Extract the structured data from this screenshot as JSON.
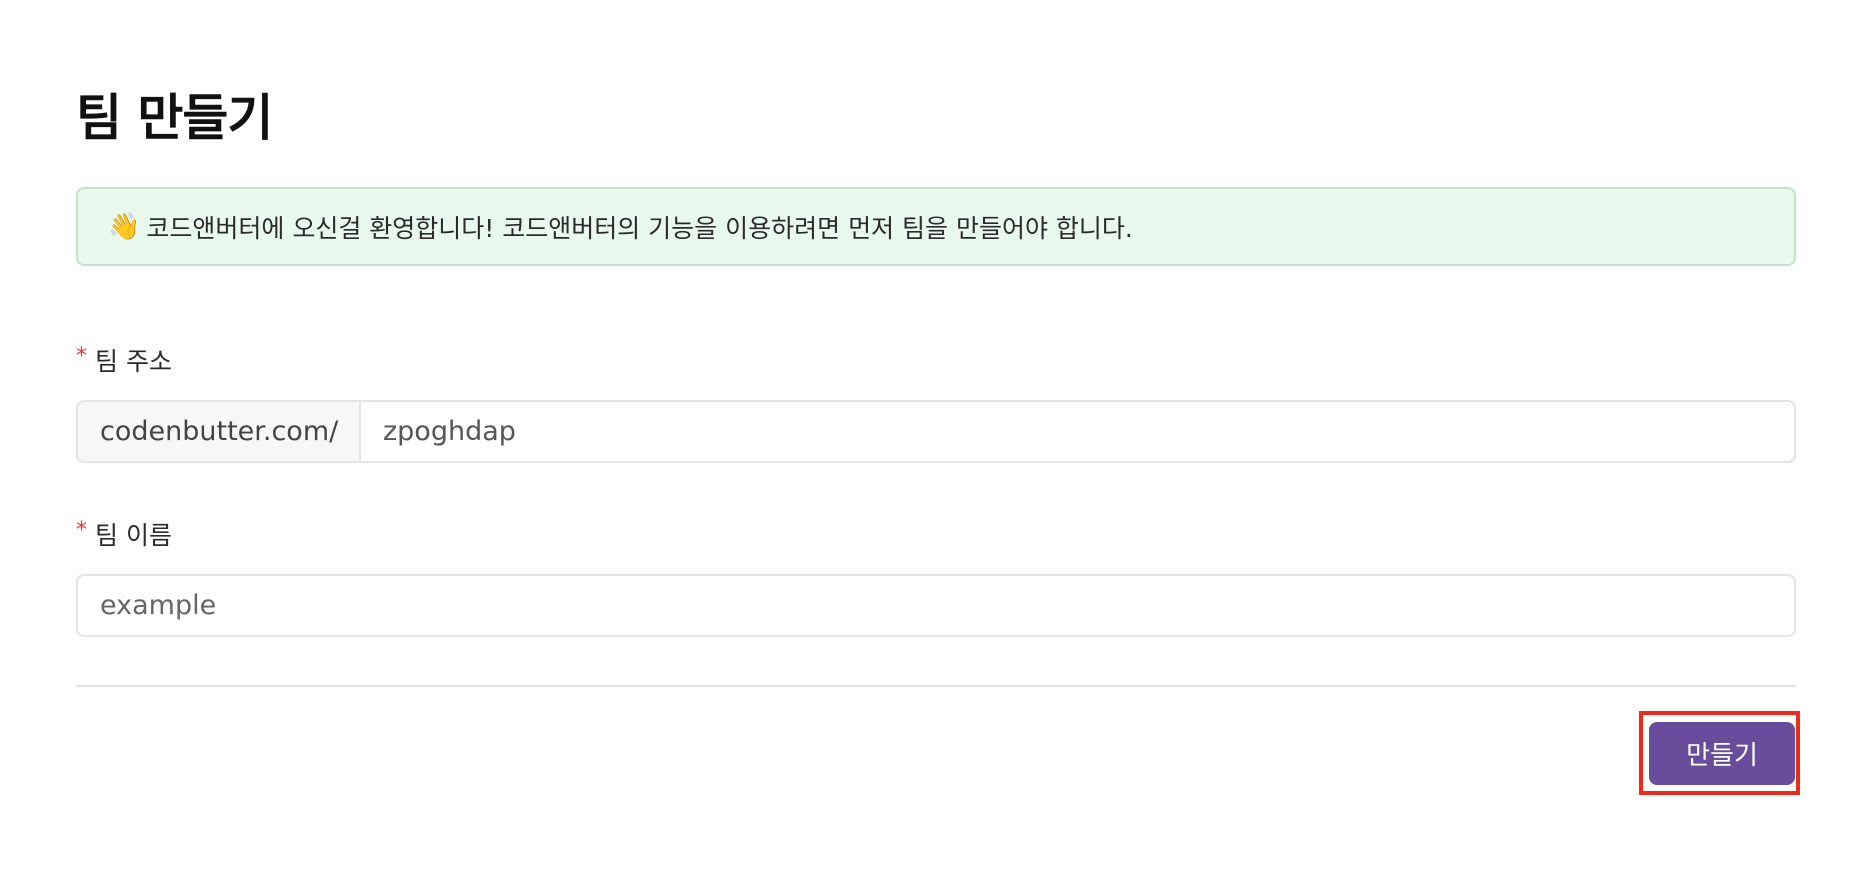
{
  "page": {
    "title": "팀 만들기"
  },
  "banner": {
    "icon": "👋",
    "icon_name": "waving-hand-icon",
    "message": "코드앤버터에 오신걸 환영합니다! 코드앤버터의 기능을 이용하려면 먼저 팀을 만들어야 합니다."
  },
  "form": {
    "required_marker": "*",
    "team_address": {
      "label": "팀 주소",
      "prefix": "codenbutter.com/",
      "value": "zpoghdap"
    },
    "team_name": {
      "label": "팀 이름",
      "placeholder": "example",
      "value": ""
    }
  },
  "actions": {
    "create_label": "만들기"
  },
  "colors": {
    "banner_background": "#e9f9ee",
    "banner_border": "#bfe4cb",
    "required_marker": "#e53935",
    "primary_button": "#6a4c9c",
    "highlight_frame": "#ee2b1a"
  }
}
